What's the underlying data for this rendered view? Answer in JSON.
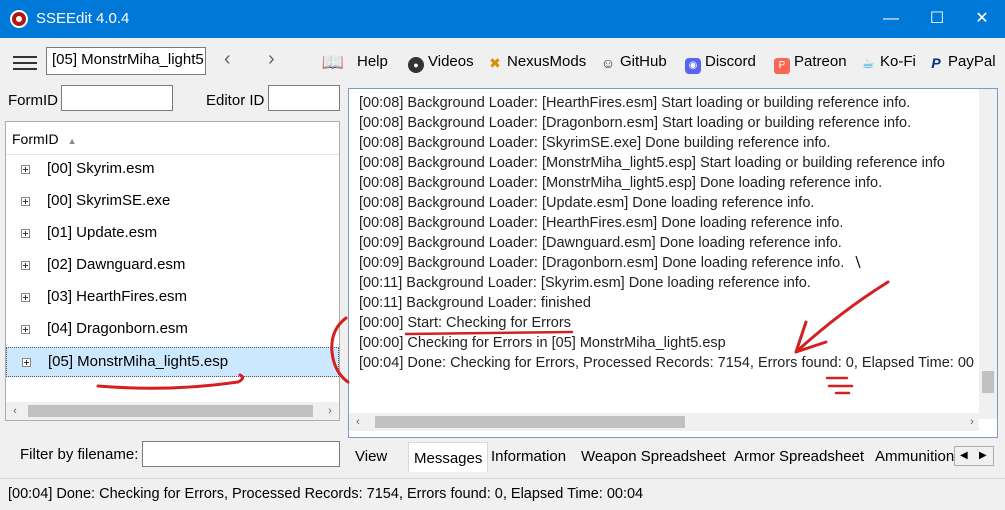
{
  "window": {
    "title": "SSEEdit 4.0.4",
    "minimize": "—",
    "maximize": "☐",
    "close": "✕"
  },
  "toolbar": {
    "plugin_selector": "[05] MonstrMiha_light5",
    "back": "‹",
    "forward": "›",
    "buttons": [
      {
        "label": "Help",
        "icon": "book-icon"
      },
      {
        "label": "Videos",
        "icon": "videos-icon"
      },
      {
        "label": "NexusMods",
        "icon": "nexusmods-icon"
      },
      {
        "label": "GitHub",
        "icon": "github-icon"
      },
      {
        "label": "Discord",
        "icon": "discord-icon"
      },
      {
        "label": "Patreon",
        "icon": "patreon-icon"
      },
      {
        "label": "Ko-Fi",
        "icon": "kofi-icon"
      },
      {
        "label": "PayPal",
        "icon": "paypal-icon"
      }
    ]
  },
  "search": {
    "formid_label": "FormID",
    "formid_value": "",
    "editorid_label": "Editor ID",
    "editorid_value": ""
  },
  "tree": {
    "header": "FormID",
    "sort_indicator": "▲",
    "items": [
      {
        "label": "[00] Skyrim.esm"
      },
      {
        "label": "[00] SkyrimSE.exe"
      },
      {
        "label": "[01] Update.esm"
      },
      {
        "label": "[02] Dawnguard.esm"
      },
      {
        "label": "[03] HearthFires.esm"
      },
      {
        "label": "[04] Dragonborn.esm"
      },
      {
        "label": "[05] MonstrMiha_light5.esp"
      }
    ],
    "selected_index": 6
  },
  "filter": {
    "label": "Filter by filename:",
    "value": ""
  },
  "messages": [
    "[00:08] Background Loader: [HearthFires.esm] Start loading or building reference info.",
    "[00:08] Background Loader: [Dragonborn.esm] Start loading or building reference info.",
    "[00:08] Background Loader: [SkyrimSE.exe] Done building reference info.",
    "[00:08] Background Loader: [MonstrMiha_light5.esp] Start loading or building reference info",
    "[00:08] Background Loader: [MonstrMiha_light5.esp] Done loading reference info.",
    "[00:08] Background Loader: [Update.esm] Done loading reference info.",
    "[00:08] Background Loader: [HearthFires.esm] Done loading reference info.",
    "[00:09] Background Loader: [Dawnguard.esm] Done loading reference info.",
    "[00:09] Background Loader: [Dragonborn.esm] Done loading reference info.",
    "[00:11] Background Loader: [Skyrim.esm] Done loading reference info.",
    "[00:11] Background Loader: finished",
    "[00:00] Start: Checking for Errors",
    "[00:00] Checking for Errors in [05] MonstrMiha_light5.esp",
    "[00:04] Done: Checking for Errors, Processed Records: 7154, Errors found: 0, Elapsed Time: 00"
  ],
  "tabs": [
    {
      "label": "View"
    },
    {
      "label": "Messages"
    },
    {
      "label": "Information"
    },
    {
      "label": "Weapon Spreadsheet"
    },
    {
      "label": "Armor Spreadsheet"
    },
    {
      "label": "Ammunition"
    }
  ],
  "active_tab": "Messages",
  "status": "[00:04] Done: Checking for Errors, Processed Records: 7154, Errors found: 0, Elapsed Time: 00:04",
  "colors": {
    "titlebar": "#0078d7",
    "selection": "#cce8ff",
    "annotation": "#d42020"
  }
}
